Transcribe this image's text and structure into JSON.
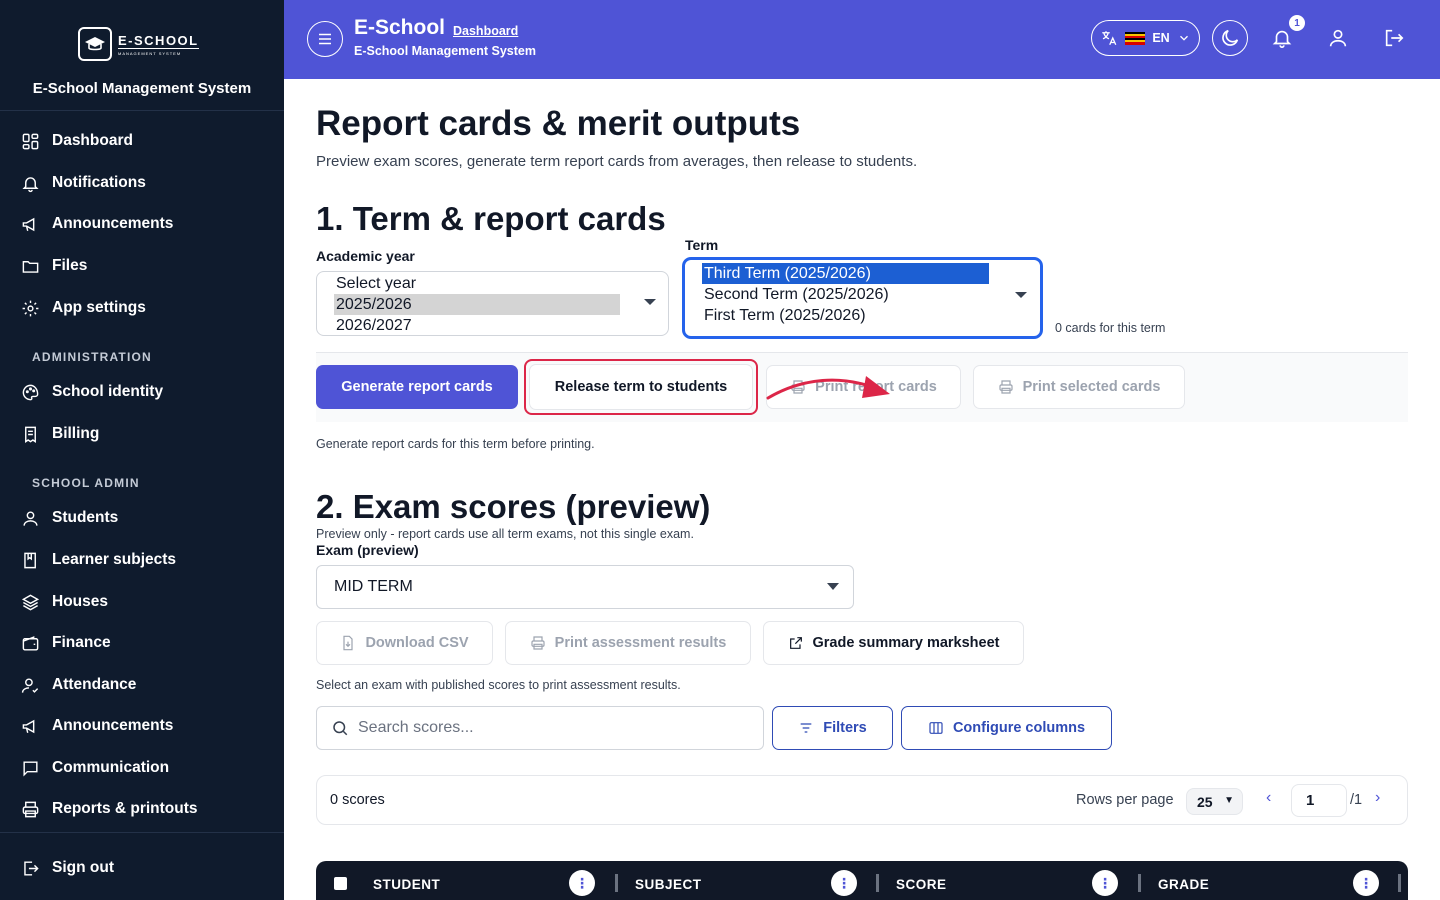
{
  "sidebar": {
    "logo_text": "E-SCHOOL",
    "logo_subtext": "MANAGEMENT SYSTEM",
    "title": "E-School Management System",
    "items_main": [
      {
        "label": "Dashboard",
        "icon": "dashboard-icon"
      },
      {
        "label": "Notifications",
        "icon": "bell-icon"
      },
      {
        "label": "Announcements",
        "icon": "megaphone-icon"
      },
      {
        "label": "Files",
        "icon": "folder-icon"
      },
      {
        "label": "App settings",
        "icon": "gear-icon"
      }
    ],
    "section_admin": "ADMINISTRATION",
    "items_admin": [
      {
        "label": "School identity",
        "icon": "palette-icon"
      },
      {
        "label": "Billing",
        "icon": "receipt-icon"
      }
    ],
    "section_school": "SCHOOL ADMIN",
    "items_school": [
      {
        "label": "Students",
        "icon": "user-icon"
      },
      {
        "label": "Learner subjects",
        "icon": "book-icon"
      },
      {
        "label": "Houses",
        "icon": "layers-icon"
      },
      {
        "label": "Finance",
        "icon": "wallet-icon"
      },
      {
        "label": "Attendance",
        "icon": "user-check-icon"
      },
      {
        "label": "Announcements",
        "icon": "megaphone-icon"
      },
      {
        "label": "Communication",
        "icon": "chat-icon"
      },
      {
        "label": "Reports & printouts",
        "icon": "printer-icon"
      }
    ],
    "sign_out": "Sign out"
  },
  "header": {
    "brand": "E-School",
    "breadcrumb": "Dashboard",
    "subtitle": "E-School Management System",
    "lang": "EN",
    "notification_count": "1",
    "accent": "#4f54d6"
  },
  "page": {
    "title": "Report cards & merit outputs",
    "lead": "Preview exam scores, generate term report cards from averages, then release to students.",
    "section1_title": "1. Term & report cards",
    "academic_year_label": "Academic year",
    "academic_year_options": [
      "Select year",
      "2025/2026",
      "2026/2027"
    ],
    "academic_year_selected": "2025/2026",
    "term_label": "Term",
    "term_options": [
      "Third Term (2025/2026)",
      "Second Term (2025/2026)",
      "First Term (2025/2026)"
    ],
    "term_selected": "Third Term (2025/2026)",
    "cards_count_note": "0 cards for this term",
    "btn_generate": "Generate report cards",
    "btn_release": "Release term to students",
    "btn_print_report": "Print report cards",
    "btn_print_selected": "Print selected cards",
    "generate_hint": "Generate report cards for this term before printing.",
    "section2_title": "2. Exam scores (preview)",
    "section2_note": "Preview only - report cards use all term exams, not this single exam.",
    "exam_label": "Exam (preview)",
    "exam_selected": "MID TERM",
    "btn_download_csv": "Download CSV",
    "btn_print_assessment": "Print assessment results",
    "btn_grade_summary": "Grade summary marksheet",
    "exam_hint": "Select an exam with published scores to print assessment results.",
    "search_placeholder": "Search scores...",
    "btn_filters": "Filters",
    "btn_configure_columns": "Configure columns",
    "scores_count": "0 scores",
    "rows_per_page_label": "Rows per page",
    "rows_per_page": "25",
    "page_current": "1",
    "page_total": "/1",
    "columns": [
      "STUDENT",
      "SUBJECT",
      "SCORE",
      "GRADE"
    ]
  }
}
